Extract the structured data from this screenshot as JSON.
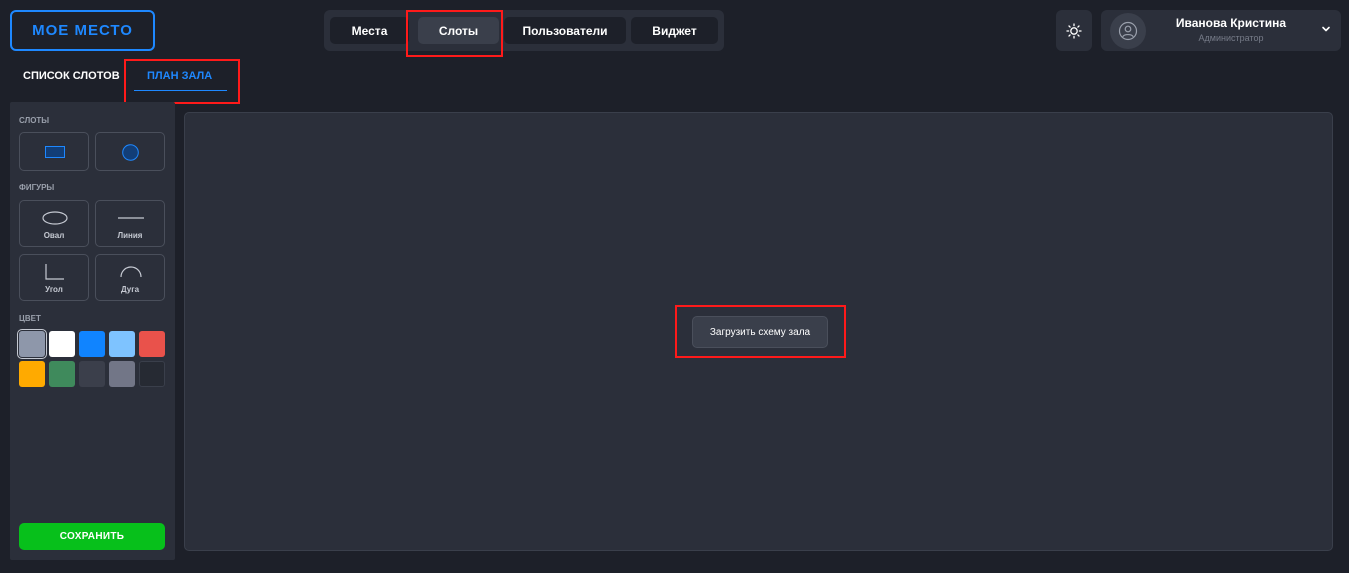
{
  "app": {
    "logo": "МОЕ МЕСТО"
  },
  "nav": {
    "tabs": [
      {
        "label": "Места"
      },
      {
        "label": "Слоты"
      },
      {
        "label": "Пользователи"
      },
      {
        "label": "Виджет"
      }
    ],
    "active": "Слоты"
  },
  "user": {
    "name": "Иванова Кристина",
    "role": "Администратор"
  },
  "subtabs": [
    {
      "label": "СПИСОК СЛОТОВ"
    },
    {
      "label": "ПЛАН ЗАЛА"
    }
  ],
  "active_subtab": "ПЛАН ЗАЛА",
  "sidebar": {
    "slots_title": "СЛОТЫ",
    "figures_title": "ФИГУРЫ",
    "figures": [
      {
        "label": "Овал",
        "icon": "oval-icon"
      },
      {
        "label": "Линия",
        "icon": "line-icon"
      },
      {
        "label": "Угол",
        "icon": "corner-icon"
      },
      {
        "label": "Дуга",
        "icon": "arc-icon"
      }
    ],
    "color_title": "ЦВЕТ",
    "colors": [
      "#8e97aa",
      "#ffffff",
      "#1084ff",
      "#7ec3ff",
      "#e9524b",
      "#ffaa00",
      "#3f8a5c",
      "#3b3f4b",
      "#727687",
      "#262a33"
    ],
    "selected_color": "#8e97aa",
    "save_label": "СОХРАНИТЬ"
  },
  "canvas": {
    "upload_label": "Загрузить схему зала"
  },
  "accent": "#1e88ff",
  "save_color": "#07c01b"
}
